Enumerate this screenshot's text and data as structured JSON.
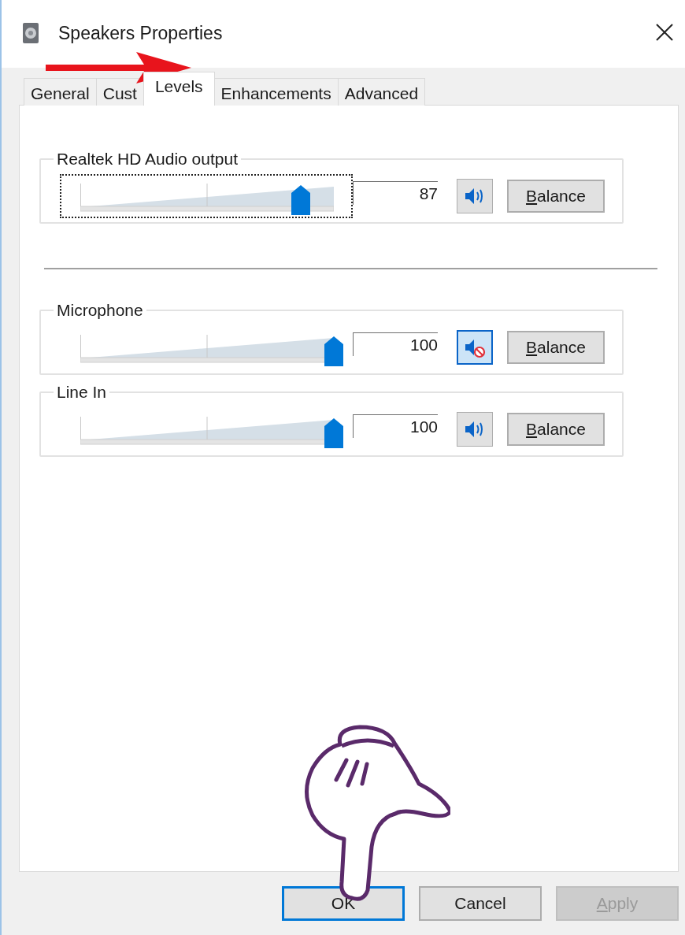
{
  "window": {
    "title": "Speakers Properties"
  },
  "tabs": [
    {
      "label": "General",
      "selected": false
    },
    {
      "label": "Cust",
      "selected": false
    },
    {
      "label": "Levels",
      "selected": true
    },
    {
      "label": "Enhancements",
      "selected": false
    },
    {
      "label": "Advanced",
      "selected": false
    }
  ],
  "devices": [
    {
      "name": "Realtek HD Audio output",
      "level": 0.87,
      "value": "87",
      "muted": false,
      "focused": true,
      "balance": {
        "label": "Balance",
        "underline_first": true
      }
    },
    {
      "name": "Microphone",
      "level": 1,
      "value": "100",
      "muted": true,
      "focused": false,
      "balance": {
        "label": "Balance",
        "underline_first": true
      }
    },
    {
      "name": "Line In",
      "level": 1,
      "value": "100",
      "muted": false,
      "focused": false,
      "balance": {
        "label": "Balance",
        "underline_first": true
      }
    }
  ],
  "buttons": [
    {
      "label": "OK",
      "default": true,
      "disabled": false,
      "underline_first": false
    },
    {
      "label": "Cancel",
      "default": false,
      "disabled": false,
      "underline_first": false
    },
    {
      "label": "Apply",
      "default": false,
      "disabled": true,
      "underline_first": true
    }
  ]
}
